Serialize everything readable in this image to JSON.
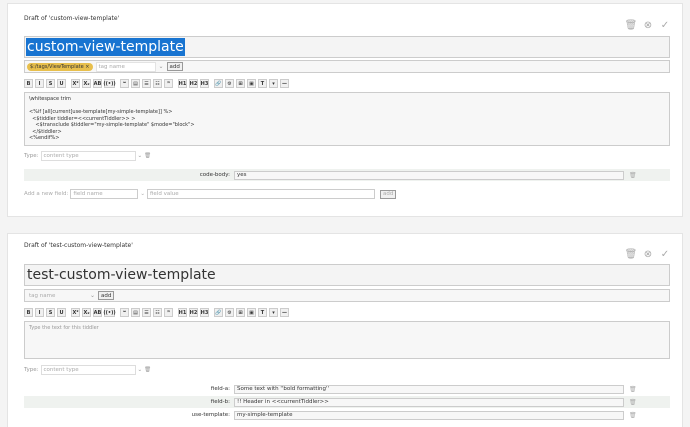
{
  "panel1": {
    "draft_label": "Draft of 'custom-view-template'",
    "title": "custom-view-template",
    "tags": [
      "$:/tags/ViewTemplate ×"
    ],
    "tag_placeholder": "tag name",
    "add_label": "add",
    "body_lines": [
      "\\whitespace trim",
      "",
      "<%if [all[current]use-template[my-simple-template]] %>",
      "  <$tiddler tiddler=<<currentTiddler>> >",
      "    <$transclude $tiddler=\"my-simple-template\" $mode=\"block\">",
      "  </$tiddler>",
      "<%endif%>"
    ],
    "type_label": "Type:",
    "type_placeholder": "content type",
    "fields": [
      {
        "name": "code-body:",
        "value": "yes"
      }
    ],
    "new_field_label": "Add a new field:",
    "new_field_name_placeholder": "field name",
    "new_field_value_placeholder": "field value",
    "new_field_add": "add"
  },
  "panel2": {
    "draft_label": "Draft of 'test-custom-view-template'",
    "title": "test-custom-view-template",
    "tag_placeholder": "tag name",
    "add_label": "add",
    "body_placeholder": "Type the text for this tiddler",
    "type_label": "Type:",
    "type_placeholder": "content type",
    "fields": [
      {
        "name": "field-a:",
        "value": "Some text with ''bold formatting''"
      },
      {
        "name": "field-b:",
        "value": "!! Header in <<currentTiddler>>"
      },
      {
        "name": "use-template:",
        "value": "my-simple-template"
      }
    ]
  },
  "toolbar": [
    "B",
    "I",
    "S",
    "U",
    "X²",
    "X₂",
    "AB",
    "((•))",
    "❝",
    "▤",
    "☰",
    "☷",
    "❞",
    "H1",
    "H2",
    "H3",
    "🔗",
    "⚙",
    "⊞",
    "▣",
    "T",
    "▾",
    "—"
  ],
  "icons": [
    "trash-icon",
    "cancel-icon",
    "checkmark-icon"
  ]
}
